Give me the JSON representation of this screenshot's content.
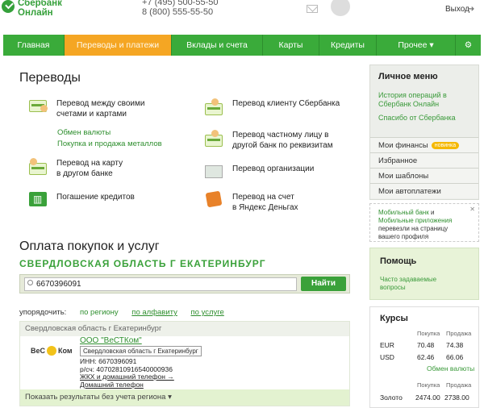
{
  "header": {
    "logo_line1": "Сбербанк",
    "logo_line2": "Онлайн",
    "phone1": "+7 (495) 500-55-50",
    "phone2": "8 (800) 555-55-50",
    "logout": "Выход"
  },
  "nav": [
    {
      "label": "Главная"
    },
    {
      "label": "Переводы и платежи"
    },
    {
      "label": "Вклады и счета"
    },
    {
      "label": "Карты"
    },
    {
      "label": "Кредиты"
    },
    {
      "label": "Прочее ▾"
    },
    {
      "label": "⚙"
    }
  ],
  "transfers": {
    "title": "Переводы",
    "own_line1": "Перевод между своими",
    "own_line2": "счетами и картами",
    "exchange": "Обмен валюты",
    "metals": "Покупка и продажа металлов",
    "card_line1": "Перевод на карту",
    "card_line2": "в другом банке",
    "loans": "Погашение кредитов",
    "client": "Перевод клиенту Сбербанка",
    "private_line1": "Перевод частному лицу в",
    "private_line2": "другой банк по реквизитам",
    "org": "Перевод организации",
    "yandex_line1": "Перевод на счет",
    "yandex_line2": "в Яндекс Деньгах"
  },
  "payments": {
    "title": "Оплата покупок и услуг",
    "region": "Свердловская область г Екатеринбург",
    "search_value": "6670396091",
    "search_button": "Найти",
    "sort_label": "упорядочить:",
    "sort_region": "по региону",
    "sort_alpha": "по алфавиту",
    "sort_service": "по услуге"
  },
  "result": {
    "region_head": "Свердловская область г Екатеринбург",
    "logo_text1": "ВеС",
    "logo_text2": "Ком",
    "company": "ООО \"ВеСТКом\"",
    "region_chip": "Свердловская область г Екатеринбург",
    "inn": "ИНН: 6670396091",
    "account": "р/сч: 40702810916540000936",
    "service1": "ЖКХ и домашний телефон →",
    "service2": "Домашний телефон",
    "show_all": "Показать результаты без учета региона ▾"
  },
  "sidebar": {
    "title": "Личное меню",
    "history_line1": "История операций в",
    "history_line2": "Сбербанк Онлайн",
    "thanks": "Спасибо от Сбербанка",
    "items": [
      {
        "label": "Мои финансы",
        "badge": "новинка"
      },
      {
        "label": "Избранное"
      },
      {
        "label": "Мои шаблоны"
      },
      {
        "label": "Мои автоплатежи"
      }
    ],
    "notice_link1": "Мобильный банк",
    "notice_and": " и ",
    "notice_link2": "Мобильные приложения",
    "notice_rest": " перевезли на страницу вашего профиля",
    "close": "✕"
  },
  "help": {
    "title": "Помощь",
    "faq_line1": "Часто задаваемые",
    "faq_line2": "вопросы"
  },
  "rates": {
    "title": "Курсы",
    "buy": "Покупка",
    "sell": "Продажа",
    "eur": {
      "code": "EUR",
      "buy": "70.48",
      "sell": "74.38"
    },
    "usd": {
      "code": "USD",
      "buy": "62.46",
      "sell": "66.06"
    },
    "exchange_link": "Обмен валюты",
    "gold": {
      "code": "Золото",
      "buy": "2474.00",
      "sell": "2738.00"
    }
  }
}
